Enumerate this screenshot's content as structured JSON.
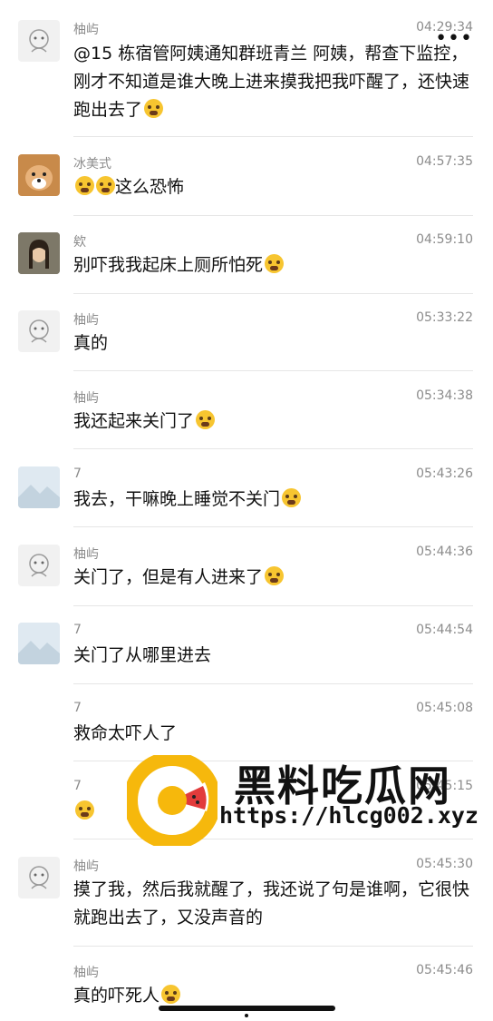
{
  "header": {
    "back_icon": "back-arrow-icon",
    "more_icon": "more-dots-icon"
  },
  "messages": [
    {
      "sender": "柚屿",
      "time": "04:29:34",
      "text": "@15 栋宿管阿姨通知群班青兰 阿姨，帮查下监控，刚才不知道是谁大晚上进来摸我把我吓醒了，还快速跑出去了",
      "emoji": "crying-face"
    },
    {
      "sender": "冰美式",
      "time": "04:57:35",
      "text": "这么恐怖",
      "emoji_prefix": "flushed-face x2"
    },
    {
      "sender": "欸",
      "time": "04:59:10",
      "text": "别吓我我起床上厕所怕死",
      "emoji": "flushed-face"
    },
    {
      "sender": "柚屿",
      "time": "05:33:22",
      "text": "真的"
    },
    {
      "sender": "柚屿",
      "time": "05:34:38",
      "text": "我还起来关门了",
      "emoji": "crying-face"
    },
    {
      "sender": "7",
      "time": "05:43:26",
      "text": "我去，干嘛晚上睡觉不关门",
      "emoji": "crying-face"
    },
    {
      "sender": "柚屿",
      "time": "05:44:36",
      "text": "关门了，但是有人进来了",
      "emoji": "crying-face"
    },
    {
      "sender": "7",
      "time": "05:44:54",
      "text": "关门了从哪里进去"
    },
    {
      "sender": "7",
      "time": "05:45:08",
      "text": "救命太吓人了"
    },
    {
      "sender": "7",
      "time": "05:45:15",
      "text": "",
      "emoji": "crying-face"
    },
    {
      "sender": "柚屿",
      "time": "05:45:30",
      "text": "摸了我，然后我就醒了，我还说了句是谁啊，它很快就跑出去了，又没声音的"
    },
    {
      "sender": "柚屿",
      "time": "05:45:46",
      "text": "真的吓死人",
      "emoji": "crying-face"
    }
  ],
  "watermark": {
    "title": "黑料吃瓜网",
    "url": "https://hlcg002.xyz"
  }
}
